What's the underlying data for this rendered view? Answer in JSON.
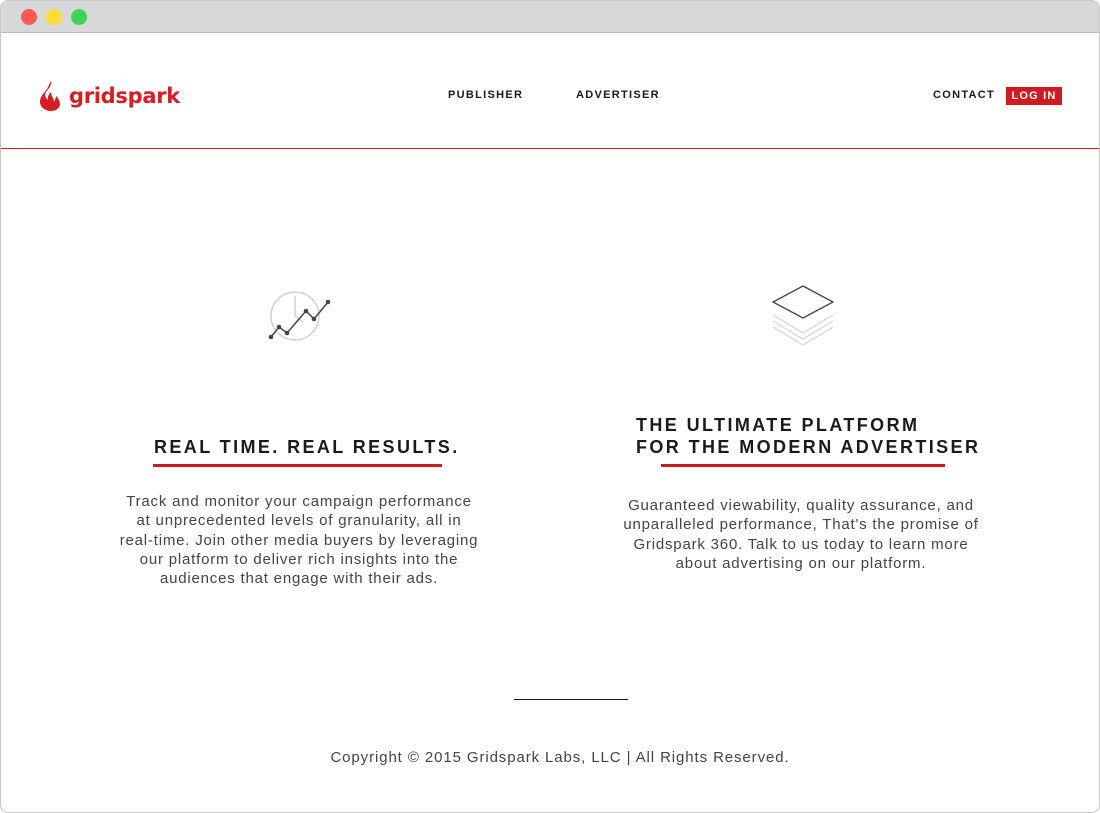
{
  "brand": {
    "name": "gridspark",
    "color": "#d71e22"
  },
  "nav": {
    "publisher": "PUBLISHER",
    "advertiser": "ADVERTISER",
    "contact": "CONTACT",
    "login": "LOG IN"
  },
  "features": [
    {
      "icon": "realtime-chart-icon",
      "title_lines": [
        "REAL TIME. REAL RESULTS."
      ],
      "body_lines": [
        "Track and monitor your campaign performance",
        "at unprecedented levels of granularity, all in",
        "real-time. Join other media buyers by leveraging",
        "our platform to deliver rich insights into the",
        "audiences that engage with their ads."
      ]
    },
    {
      "icon": "layers-icon",
      "title_lines": [
        "THE ULTIMATE PLATFORM",
        "FOR THE MODERN ADVERTISER"
      ],
      "body_lines": [
        "Guaranteed viewability, quality assurance, and",
        "unparalleled performance, That's the promise of",
        "Gridspark 360. Talk to us today to learn more",
        "about advertising on our platform."
      ]
    }
  ],
  "footer": {
    "copyright": "Copyright © 2015 Gridspark Labs, LLC | All Rights Reserved."
  },
  "colors": {
    "accent": "#d21a21",
    "text": "#1a1a1a",
    "body_text": "#444444"
  }
}
